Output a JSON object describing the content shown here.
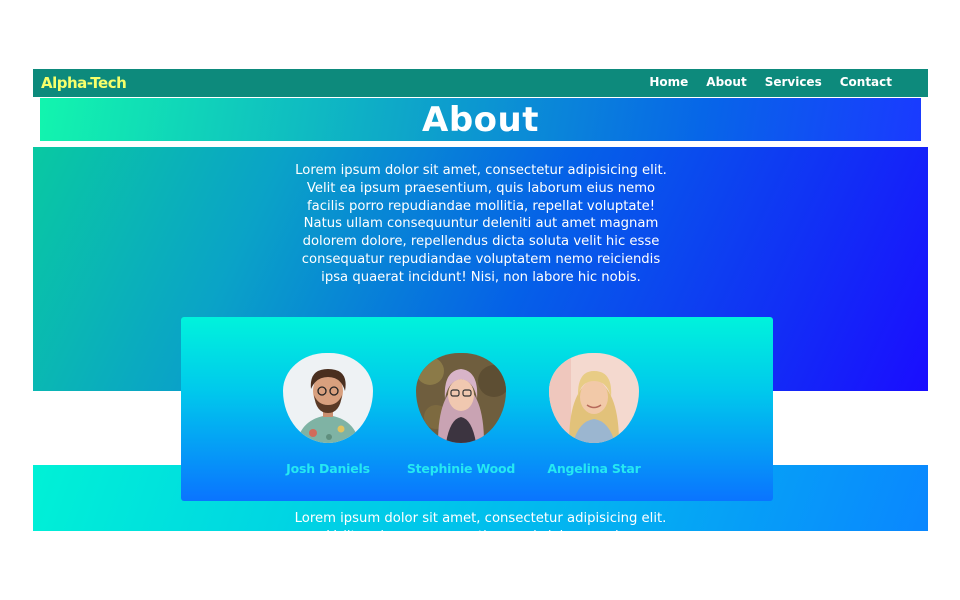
{
  "navbar": {
    "brand": "Alpha-Tech",
    "links": [
      {
        "label": "Home"
      },
      {
        "label": "About"
      },
      {
        "label": "Services"
      },
      {
        "label": "Contact"
      }
    ]
  },
  "about": {
    "title": "About",
    "paragraph": "Lorem ipsum dolor sit amet, consectetur adipisicing elit. Velit ea ipsum praesentium, quis laborum eius nemo facilis porro repudiandae mollitia, repellat voluptate! Natus ullam consequuntur deleniti aut amet magnam dolorem dolore, repellendus dicta soluta velit hic esse consequatur repudiandae voluptatem nemo reiciendis ipsa quaerat incidunt! Nisi, non labore hic nobis."
  },
  "team": {
    "members": [
      {
        "name": "Josh Daniels"
      },
      {
        "name": "Stephinie Wood"
      },
      {
        "name": "Angelina Star"
      }
    ]
  },
  "lower": {
    "paragraph": "Lorem ipsum dolor sit amet, consectetur adipisicing elit. Velit ea ipsum praesentium, quis laborum eius"
  },
  "colors": {
    "navbar": "#0d8a7c",
    "brand": "#f7ff6a",
    "member_name": "#25e8f2"
  }
}
